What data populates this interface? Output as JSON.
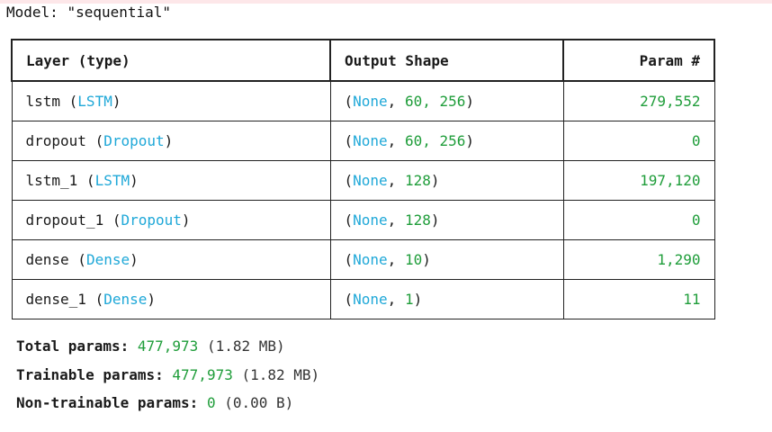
{
  "model": {
    "title_prefix": "Model: ",
    "name": "\"sequential\""
  },
  "table": {
    "headers": {
      "layer": "Layer (type)",
      "output": "Output Shape",
      "params": "Param #"
    },
    "rows": [
      {
        "name": "lstm",
        "type": "LSTM",
        "shape_rest": "60, 256",
        "params": "279,552"
      },
      {
        "name": "dropout",
        "type": "Dropout",
        "shape_rest": "60, 256",
        "params": "0"
      },
      {
        "name": "lstm_1",
        "type": "LSTM",
        "shape_rest": "128",
        "params": "197,120"
      },
      {
        "name": "dropout_1",
        "type": "Dropout",
        "shape_rest": "128",
        "params": "0"
      },
      {
        "name": "dense",
        "type": "Dense",
        "shape_rest": "10",
        "params": "1,290"
      },
      {
        "name": "dense_1",
        "type": "Dense",
        "shape_rest": "1",
        "params": "11"
      }
    ],
    "none_token": "None"
  },
  "totals": {
    "total": {
      "label": "Total params:",
      "value": "477,973",
      "size": "(1.82 MB)"
    },
    "trainable": {
      "label": "Trainable params:",
      "value": "477,973",
      "size": "(1.82 MB)"
    },
    "non_trainable": {
      "label": "Non-trainable params:",
      "value": "0",
      "size": "(0.00 B)"
    }
  },
  "colors": {
    "cyan": "#1fa8d8",
    "green": "#1f9d3a"
  }
}
